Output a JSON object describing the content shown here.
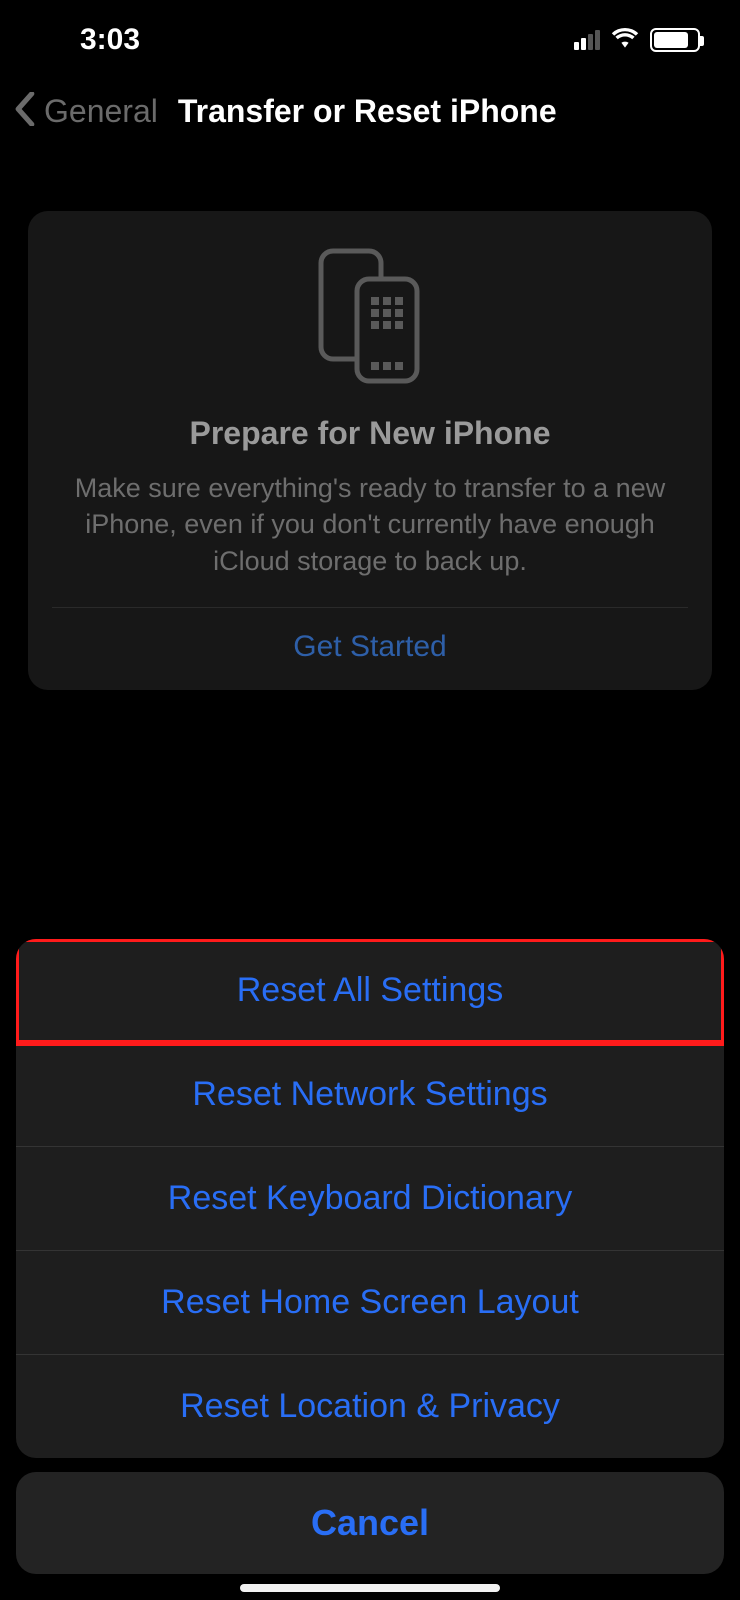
{
  "statusbar": {
    "time": "3:03"
  },
  "nav": {
    "back_label": "General",
    "title": "Transfer or Reset iPhone"
  },
  "card": {
    "title": "Prepare for New iPhone",
    "body": "Make sure everything's ready to transfer to a new iPhone, even if you don't currently have enough iCloud storage to back up.",
    "action": "Get Started"
  },
  "sheet": {
    "items": [
      "Reset All Settings",
      "Reset Network Settings",
      "Reset Keyboard Dictionary",
      "Reset Home Screen Layout",
      "Reset Location & Privacy"
    ],
    "cancel": "Cancel"
  }
}
